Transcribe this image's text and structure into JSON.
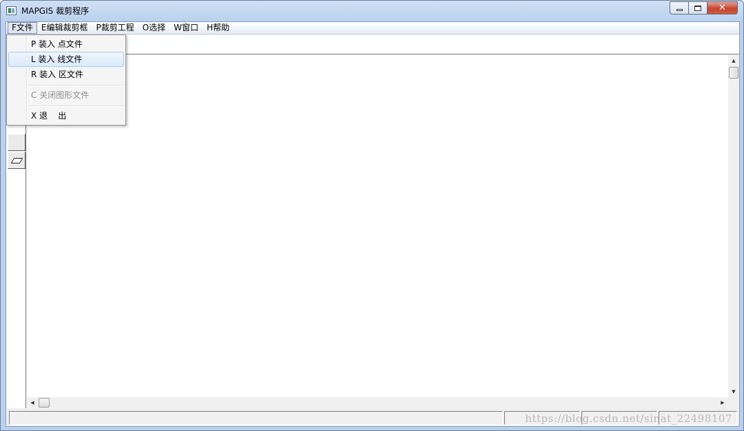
{
  "window": {
    "title": "MAPGIS 裁剪程序",
    "controls": {
      "minimize": "",
      "maximize": "",
      "close": "✕"
    }
  },
  "menubar": {
    "items": [
      {
        "label": "F文件",
        "active": true
      },
      {
        "label": "E编辑裁剪框"
      },
      {
        "label": "P裁剪工程"
      },
      {
        "label": "O选择"
      },
      {
        "label": "W窗口"
      },
      {
        "label": "H帮助"
      }
    ]
  },
  "file_menu": {
    "items": [
      {
        "label": "P 装入 点文件"
      },
      {
        "label": "L 装入 线文件",
        "highlighted": true
      },
      {
        "label": "R 装入 区文件"
      },
      {
        "label": "C 关闭图形文件",
        "disabled": true
      },
      {
        "label": "X 退    出"
      }
    ]
  },
  "scrollbars": {
    "up_arrow": "▲",
    "down_arrow": "▼",
    "left_arrow": "◀",
    "right_arrow": "▶"
  },
  "statusbar": {
    "watermark": "https://blog.csdn.net/sinat_22498107"
  }
}
